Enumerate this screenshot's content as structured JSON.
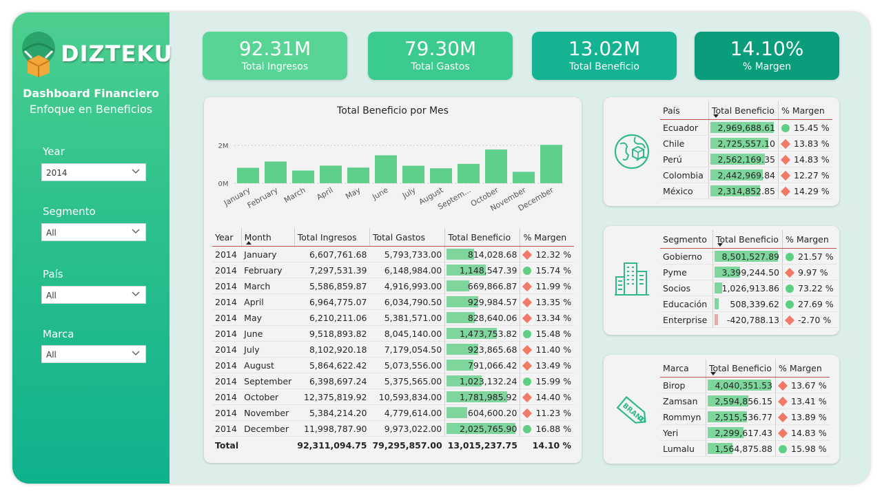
{
  "brand": {
    "logo_text": "DIZTEKU",
    "title": "Dashboard Financiero",
    "subtitle": "Enfoque en Beneficios"
  },
  "slicers": [
    {
      "label": "Year",
      "value": "2014"
    },
    {
      "label": "Segmento",
      "value": "All"
    },
    {
      "label": "País",
      "value": "All"
    },
    {
      "label": "Marca",
      "value": "All"
    }
  ],
  "kpis": [
    {
      "value": "92.31M",
      "label": "Total Ingresos",
      "color": "#58d494"
    },
    {
      "value": "79.30M",
      "label": "Total Gastos",
      "color": "#3ccb8e"
    },
    {
      "value": "13.02M",
      "label": "Total Beneficio",
      "color": "#14b392"
    },
    {
      "value": "14.10%",
      "label": "% Margen",
      "color": "#0a9d7c"
    }
  ],
  "chart_data": {
    "type": "bar",
    "title": "Total Beneficio por Mes",
    "categories": [
      "January",
      "February",
      "March",
      "April",
      "May",
      "June",
      "July",
      "August",
      "Septem...",
      "October",
      "November",
      "December"
    ],
    "values": [
      814028.68,
      1148547.39,
      669866.87,
      929984.57,
      828640.06,
      1473753.82,
      923865.68,
      791066.42,
      1023132.24,
      1781985.92,
      604600.2,
      2025765.9
    ],
    "ylim": [
      0,
      2000000
    ],
    "yticks": [
      "0M",
      "2M"
    ],
    "color": "#5fcf8b"
  },
  "month_table": {
    "headers": [
      "Year",
      "Month",
      "Total Ingresos",
      "Total Gastos",
      "Total Beneficio",
      "% Margen"
    ],
    "rows": [
      [
        "2014",
        "January",
        "6,607,761.68",
        "5,793,733.00",
        "814,028.68",
        "12.32 %",
        "diamond",
        814028.68
      ],
      [
        "2014",
        "February",
        "7,297,531.39",
        "6,148,984.00",
        "1,148,547.39",
        "15.74 %",
        "circle",
        1148547.39
      ],
      [
        "2014",
        "March",
        "5,586,859.87",
        "4,916,993.00",
        "669,866.87",
        "11.99 %",
        "diamond",
        669866.87
      ],
      [
        "2014",
        "April",
        "6,964,775.07",
        "6,034,790.50",
        "929,984.57",
        "13.35 %",
        "diamond",
        929984.57
      ],
      [
        "2014",
        "May",
        "6,210,211.06",
        "5,381,571.00",
        "828,640.06",
        "13.34 %",
        "diamond",
        828640.06
      ],
      [
        "2014",
        "June",
        "9,518,893.82",
        "8,045,140.00",
        "1,473,753.82",
        "15.48 %",
        "circle",
        1473753.82
      ],
      [
        "2014",
        "July",
        "8,102,920.18",
        "7,179,054.50",
        "923,865.68",
        "11.40 %",
        "diamond",
        923865.68
      ],
      [
        "2014",
        "August",
        "5,864,622.42",
        "5,073,556.00",
        "791,066.42",
        "13.49 %",
        "diamond",
        791066.42
      ],
      [
        "2014",
        "September",
        "6,398,697.24",
        "5,375,565.00",
        "1,023,132.24",
        "15.99 %",
        "circle",
        1023132.24
      ],
      [
        "2014",
        "October",
        "12,375,819.92",
        "10,593,834.00",
        "1,781,985.92",
        "14.40 %",
        "diamond",
        1781985.92
      ],
      [
        "2014",
        "November",
        "5,384,214.20",
        "4,779,614.00",
        "604,600.20",
        "11.23 %",
        "diamond",
        604600.2
      ],
      [
        "2014",
        "December",
        "11,998,787.90",
        "9,973,022.00",
        "2,025,765.90",
        "16.88 %",
        "circle",
        2025765.9
      ]
    ],
    "total": [
      "Total",
      "",
      "92,311,094.75",
      "79,295,857.00",
      "13,015,237.75",
      "14.10 %"
    ]
  },
  "country_table": {
    "headers": [
      "País",
      "Total Beneficio",
      "% Margen"
    ],
    "rows": [
      [
        "Ecuador",
        "2,969,688.61",
        "15.45 %",
        "circle",
        2969688.61
      ],
      [
        "Chile",
        "2,725,557.10",
        "13.83 %",
        "diamond",
        2725557.1
      ],
      [
        "Perú",
        "2,562,169.35",
        "14.83 %",
        "diamond",
        2562169.35
      ],
      [
        "Colombia",
        "2,442,969.84",
        "12.27 %",
        "diamond",
        2442969.84
      ],
      [
        "México",
        "2,314,852.85",
        "14.29 %",
        "diamond",
        2314852.85
      ]
    ]
  },
  "segment_table": {
    "headers": [
      "Segmento",
      "Total Beneficio",
      "% Margen"
    ],
    "rows": [
      [
        "Gobierno",
        "8,501,527.89",
        "21.57 %",
        "circle",
        8501527.89
      ],
      [
        "Pyme",
        "3,399,244.50",
        "9.97 %",
        "diamond",
        3399244.5
      ],
      [
        "Socios",
        "1,026,913.86",
        "73.22 %",
        "circle",
        1026913.86
      ],
      [
        "Educación",
        "508,339.62",
        "27.69 %",
        "circle",
        508339.62
      ],
      [
        "Enterprise",
        "-420,788.13",
        "-2.70 %",
        "diamond",
        -420788.13
      ]
    ]
  },
  "brand_table": {
    "headers": [
      "Marca",
      "Total Beneficio",
      "% Margen"
    ],
    "rows": [
      [
        "Birop",
        "4,040,351.53",
        "13.67 %",
        "diamond",
        4040351.53
      ],
      [
        "Zamsan",
        "2,594,856.15",
        "13.41 %",
        "diamond",
        2594856.15
      ],
      [
        "Rommyn",
        "2,515,536.77",
        "13.89 %",
        "diamond",
        2515536.77
      ],
      [
        "Yeri",
        "2,299,617.43",
        "14.83 %",
        "diamond",
        2299617.43
      ],
      [
        "Lumalu",
        "1,564,875.88",
        "15.98 %",
        "circle",
        1564875.88
      ]
    ]
  },
  "icons": {
    "country": "globe-icon",
    "segment": "buildings-icon",
    "brand": "brand-tag-icon"
  }
}
